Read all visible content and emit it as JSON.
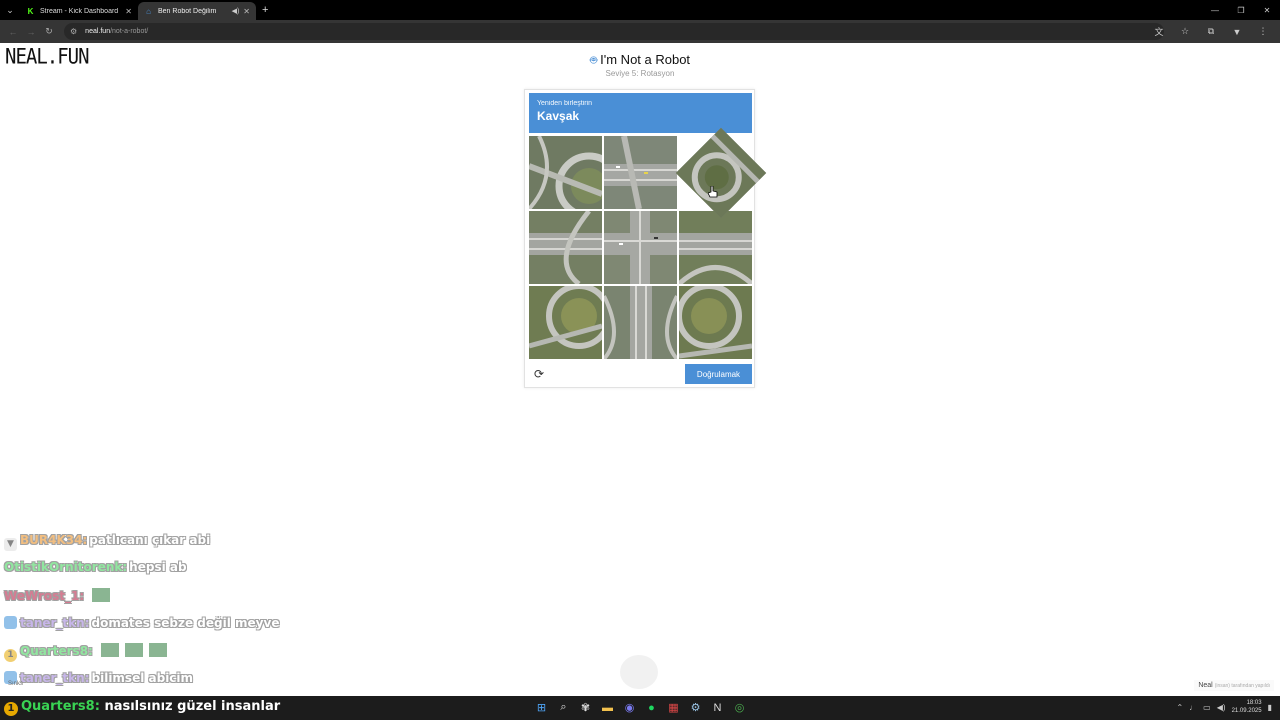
{
  "browser": {
    "tabs": [
      {
        "title": "Stream - Kick Dashboard",
        "favicon": "kick-icon",
        "active": false
      },
      {
        "title": "Ben Robot Değilim",
        "favicon": "neal-icon",
        "active": true
      }
    ],
    "url_host": "neal.fun",
    "url_path": "/not-a-robot/"
  },
  "page": {
    "logo": "NEAL.FUN",
    "title": "I'm Not a Robot",
    "subtitle": "Seviye 5: Rotasyon",
    "credit_name": "Neal",
    "credit_sub": "(insan) tarafından yapıldı"
  },
  "captcha": {
    "instruction": "Yeniden birleştirin",
    "target": "Kavşak",
    "verify_label": "Doğrulamak",
    "accent": "#4a8fd6"
  },
  "chat": [
    {
      "user": "BUR4K34:",
      "text": "patlıcanı çıkar abi",
      "user_color": "#e88a1a",
      "badge": "heart-icon"
    },
    {
      "user": "OtistikOrnitorenk:",
      "text": "hepsi ab",
      "user_color": "#39d353",
      "badge": ""
    },
    {
      "user": "WeWrost_1:",
      "text": "",
      "user_color": "#b3123a",
      "badge": "",
      "emotes": 1
    },
    {
      "user": "taner_tkn:",
      "text": "domates sebze değil meyve",
      "user_color": "#9b7bd8",
      "badge": "cube-icon"
    },
    {
      "user": "Quarters8:",
      "text": "",
      "user_color": "#39d353",
      "badge": "coin-icon",
      "emotes": 3
    },
    {
      "user": "taner_tkn:",
      "text": "bilimsel abicim",
      "user_color": "#9b7bd8",
      "badge": "cube-icon"
    }
  ],
  "chat_last": {
    "user": "Quarters8:",
    "text": "nasılsınız güzel insanlar",
    "badge_text": "1"
  },
  "taskbar": {
    "time": "18:03",
    "date": "21.09.2025",
    "sinks_label": "Sınks"
  }
}
